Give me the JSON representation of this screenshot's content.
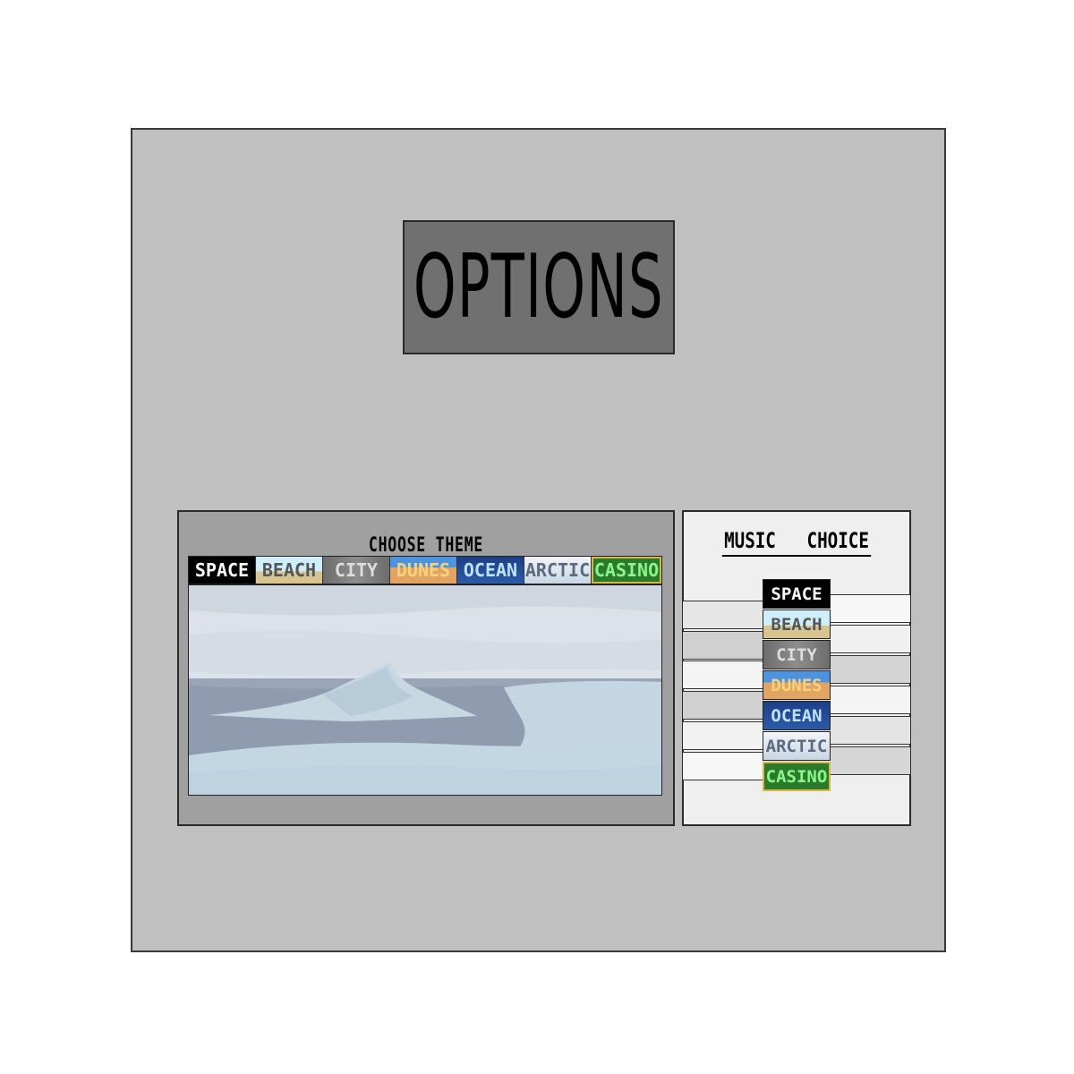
{
  "title": "OPTIONS",
  "theme_section": {
    "label": "CHOOSE THEME",
    "tabs": [
      "SPACE",
      "BEACH",
      "CITY",
      "DUNES",
      "OCEAN",
      "ARCTIC",
      "CASINO"
    ],
    "selected": "ARCTIC"
  },
  "music_section": {
    "label": "MUSIC   CHOICE",
    "options": [
      "SPACE",
      "BEACH",
      "CITY",
      "DUNES",
      "OCEAN",
      "ARCTIC",
      "CASINO"
    ]
  },
  "colors": {
    "frame_bg": "#c0c0c0",
    "title_bg": "#707070",
    "theme_panel_bg": "#a0a0a0",
    "music_panel_bg": "#efefef",
    "space": "#000000",
    "beach": "#cfeefc",
    "city": "#7d7d7d",
    "dunes": "#e2a463",
    "ocean": "#2c5aa8",
    "arctic": "#dde3ea",
    "casino": "#2b7a2b"
  }
}
